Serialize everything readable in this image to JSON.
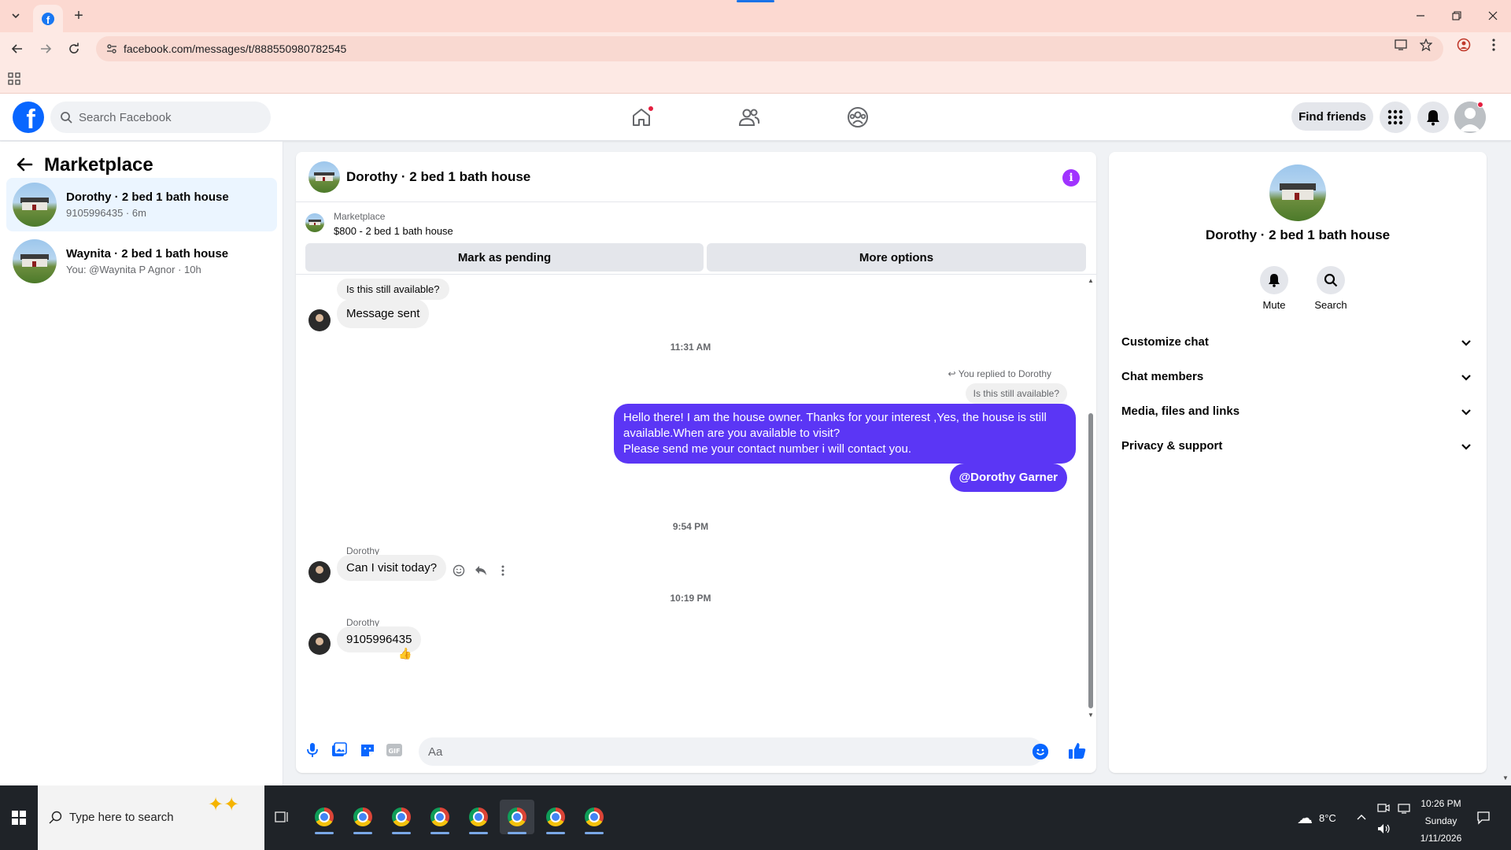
{
  "browser": {
    "url": "facebook.com/messages/t/888550980782545",
    "tab_icon": "facebook-icon",
    "new_tab_label": "+"
  },
  "header": {
    "search_placeholder": "Search Facebook",
    "find_friends_label": "Find friends"
  },
  "sidebar": {
    "title": "Marketplace",
    "conversations": [
      {
        "name": "Dorothy · 2 bed 1 bath house",
        "subtitle": "9105996435 · 6m",
        "active": true
      },
      {
        "name": "Waynita · 2 bed 1 bath house",
        "subtitle": "You: @Waynita P Agnor · 10h",
        "active": false
      }
    ]
  },
  "chat": {
    "title": "Dorothy · 2 bed 1 bath house",
    "listing_label": "Marketplace",
    "listing_price": "$800 - 2 bed 1 bath house",
    "mark_pending_label": "Mark as pending",
    "more_options_label": "More options",
    "messages": {
      "m1": "Is this still available?",
      "m2": "Message sent",
      "ts1": "11:31 AM",
      "replied_note": "You replied to Dorothy",
      "replied_quote": "Is this still available?",
      "m3_line1": "Hello there! I am the house owner. Thanks for your interest ,Yes, the house is still available.When are you available to visit?",
      "m3_line2": "Please send me your contact number i will contact you.",
      "m4": "@Dorothy Garner",
      "ts2": "9:54 PM",
      "sender1": "Dorothy",
      "m5": "Can I visit today?",
      "ts3": "10:19 PM",
      "sender2": "Dorothy",
      "m6": "9105996435",
      "m6_reaction": "👍"
    },
    "composer_placeholder": "Aa"
  },
  "details": {
    "name": "Dorothy · 2 bed 1 bath house",
    "mute_label": "Mute",
    "search_label": "Search",
    "sections": [
      "Customize chat",
      "Chat members",
      "Media, files and links",
      "Privacy & support"
    ]
  },
  "taskbar": {
    "search_placeholder": "Type here to search",
    "weather": "8°C",
    "time": "10:26 PM",
    "day": "Sunday",
    "date": "1/11/2026"
  },
  "colors": {
    "brand": "#0866ff",
    "my_bubble": "#5b36f5",
    "info_icon": "#a033ff",
    "browser_frame": "#fcd9d1"
  }
}
